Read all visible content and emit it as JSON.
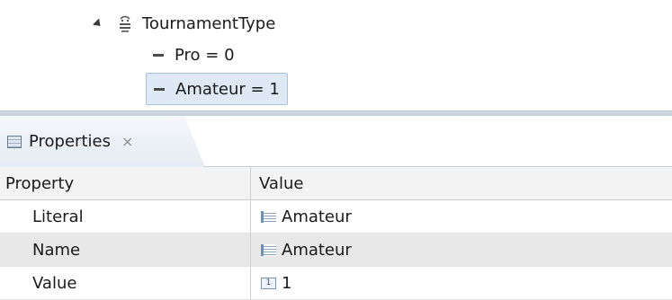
{
  "tree": {
    "enum_name": "TournamentType",
    "literals": [
      {
        "label": "Pro = 0"
      },
      {
        "label": "Amateur = 1",
        "selected": true
      }
    ]
  },
  "properties_view": {
    "tab_label": "Properties",
    "tab_close_icon": "close-icon",
    "columns": [
      "Property",
      "Value"
    ],
    "rows": [
      {
        "property": "Literal",
        "value": "Amateur",
        "value_icon": "text-value-icon"
      },
      {
        "property": "Name",
        "value": "Amateur",
        "value_icon": "text-value-icon"
      },
      {
        "property": "Value",
        "value": "1",
        "value_icon": "number-value-icon"
      }
    ]
  },
  "colors": {
    "selection_bg": "#dfe9f5",
    "selection_border": "#a9c2de",
    "alt_row": "#e8e8e8",
    "header_bg": "#f3f3f3"
  }
}
